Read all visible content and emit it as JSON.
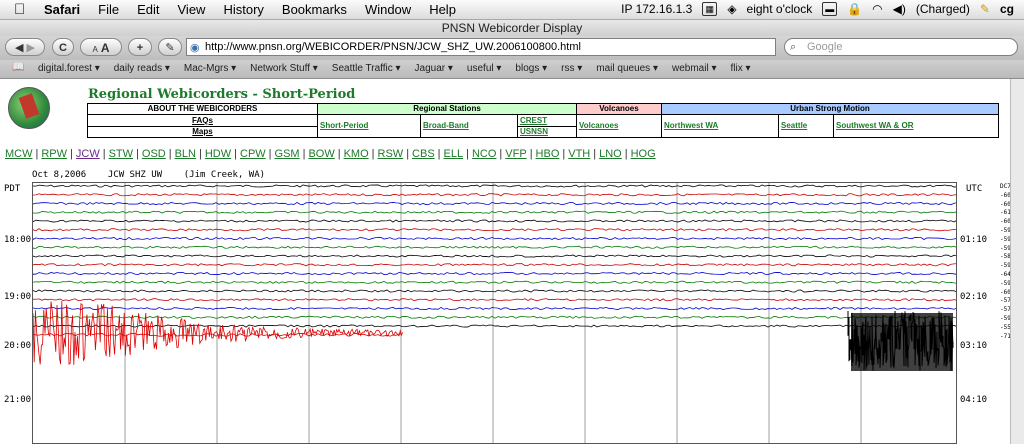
{
  "menubar": {
    "apple": "",
    "menus": [
      "Safari",
      "File",
      "Edit",
      "View",
      "History",
      "Bookmarks",
      "Window",
      "Help"
    ],
    "ip": "IP 172.16.1.3",
    "clock": "eight o'clock",
    "battery": "(Charged)",
    "user": "cg"
  },
  "window": {
    "title": "PNSN Webicorder Display"
  },
  "toolbar": {
    "back": "◀",
    "forward": "▶",
    "reload": "C",
    "text_smaller": "A",
    "text_larger": "A",
    "add": "+",
    "edit": "✎",
    "url": "http://www.pnsn.org/WEBICORDER/PNSN/JCW_SHZ_UW.2006100800.html",
    "search_placeholder": "Google"
  },
  "bookmarks": [
    "digital.forest",
    "daily reads",
    "Mac-Mgrs",
    "Network Stuff",
    "Seattle Traffic",
    "Jaguar",
    "useful",
    "blogs",
    "rss",
    "mail queues",
    "webmail",
    "flix"
  ],
  "page": {
    "title": "Regional Webicorders - Short-Period",
    "nav": {
      "about": "ABOUT THE WEBICORDERS",
      "faqs": "FAQs",
      "maps": "Maps",
      "regional": "Regional Stations",
      "short_period": "Short-Period",
      "broad_band": "Broad-Band",
      "crest": "CREST",
      "usnsn": "USNSN",
      "volcanoes_hdr": "Volcanoes",
      "volcanoes": "Volcanoes",
      "urban": "Urban Strong Motion",
      "nw_wa": "Northwest WA",
      "seattle": "Seattle",
      "sw_wa": "Southwest WA & OR"
    },
    "stations": [
      "MCW",
      "RPW",
      "JCW",
      "STW",
      "OSD",
      "BLN",
      "HDW",
      "CPW",
      "GSM",
      "BOW",
      "KMO",
      "RSW",
      "CBS",
      "ELL",
      "NCO",
      "VFP",
      "HBO",
      "VTH",
      "LNO",
      "HOG"
    ],
    "current_station": "JCW"
  },
  "webicorder": {
    "date": "Oct 8,2006",
    "channel": "JCW SHZ UW",
    "site": "(Jim Creek, WA)",
    "left_tz": "PDT",
    "right_tz": "UTC",
    "left_times": [
      "18:00",
      "19:00",
      "20:00",
      "21:00"
    ],
    "right_times": [
      "01:10",
      "02:10",
      "03:10",
      "04:10"
    ],
    "right_values": [
      "DC73",
      "-60",
      "-60",
      "-61",
      "-60",
      "-59",
      "-59",
      "-59",
      "-58",
      "-59",
      "-64",
      "-59",
      "-60",
      "-57",
      "-57",
      "-59",
      "-55",
      "-71"
    ],
    "trace_colors": [
      "#000000",
      "#cc0000",
      "#0000cc",
      "#007a00"
    ]
  }
}
